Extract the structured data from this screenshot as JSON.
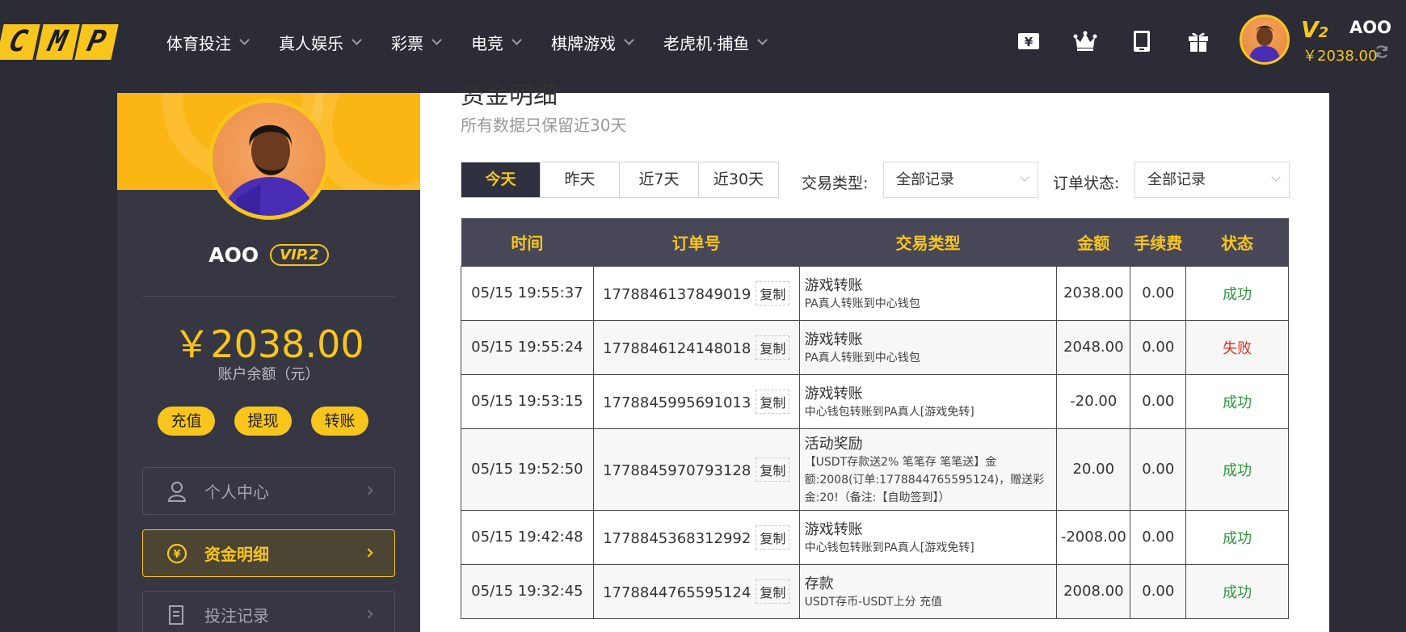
{
  "logo": {
    "letters": [
      "C",
      "M",
      "P"
    ]
  },
  "nav": [
    {
      "label": "体育投注"
    },
    {
      "label": "真人娱乐"
    },
    {
      "label": "彩票"
    },
    {
      "label": "电竞"
    },
    {
      "label": "棋牌游戏"
    },
    {
      "label": "老虎机·捕鱼"
    }
  ],
  "top_icons": [
    "currency-icon",
    "crown-icon",
    "tablet-icon",
    "gift-icon"
  ],
  "user": {
    "name": "AOO",
    "vip_badge": "V",
    "vip_level": "2",
    "balance": "￥2038.00"
  },
  "sidebar": {
    "name": "AOO",
    "vip": "VIP.2",
    "balance": "￥2038.00",
    "balance_label": "账户余额（元）",
    "actions": [
      "充值",
      "提现",
      "转账"
    ],
    "menu": [
      {
        "label": "个人中心",
        "icon": "user-icon",
        "active": false
      },
      {
        "label": "资金明细",
        "icon": "yuan-circle-icon",
        "active": true
      },
      {
        "label": "投注记录",
        "icon": "document-icon",
        "active": false
      }
    ]
  },
  "main": {
    "title": "资金明细",
    "subtitle": "所有数据只保留近30天",
    "tabs": [
      "今天",
      "昨天",
      "近7天",
      "近30天"
    ],
    "active_tab": "今天",
    "filter_type_label": "交易类型:",
    "filter_type_value": "全部记录",
    "filter_status_label": "订单状态:",
    "filter_status_value": "全部记录"
  },
  "table": {
    "headers": [
      "时间",
      "订单号",
      "交易类型",
      "金额",
      "手续费",
      "状态"
    ],
    "copy_label": "复制",
    "rows": [
      {
        "time": "05/15 19:55:37",
        "order": "1778846137849019",
        "type": "游戏转账",
        "desc": "PA真人转账到中心钱包",
        "amount": "2038.00",
        "fee": "0.00",
        "status": "成功",
        "ok": true
      },
      {
        "time": "05/15 19:55:24",
        "order": "1778846124148018",
        "type": "游戏转账",
        "desc": "PA真人转账到中心钱包",
        "amount": "2048.00",
        "fee": "0.00",
        "status": "失败",
        "ok": false
      },
      {
        "time": "05/15 19:53:15",
        "order": "1778845995691013",
        "type": "游戏转账",
        "desc": "中心钱包转账到PA真人[游戏免转]",
        "amount": "-20.00",
        "fee": "0.00",
        "status": "成功",
        "ok": true
      },
      {
        "time": "05/15 19:52:50",
        "order": "1778845970793128",
        "type": "活动奖励",
        "desc": "【USDT存款送2% 笔笔存 笔笔送】金额:2008(订单:1778844765595124)，赠送彩金:20!（备注:【自助签到】）",
        "amount": "20.00",
        "fee": "0.00",
        "status": "成功",
        "ok": true
      },
      {
        "time": "05/15 19:42:48",
        "order": "1778845368312992",
        "type": "游戏转账",
        "desc": "中心钱包转账到PA真人[游戏免转]",
        "amount": "-2008.00",
        "fee": "0.00",
        "status": "成功",
        "ok": true
      },
      {
        "time": "05/15 19:32:45",
        "order": "1778844765595124",
        "type": "存款",
        "desc": "USDT存币-USDT上分 充值",
        "amount": "2008.00",
        "fee": "0.00",
        "status": "成功",
        "ok": true
      }
    ]
  },
  "colors": {
    "accent": "#f8c51d",
    "bg": "#2b2c36",
    "success": "#2e9a3a",
    "fail": "#e0301e",
    "header": "#474758"
  }
}
